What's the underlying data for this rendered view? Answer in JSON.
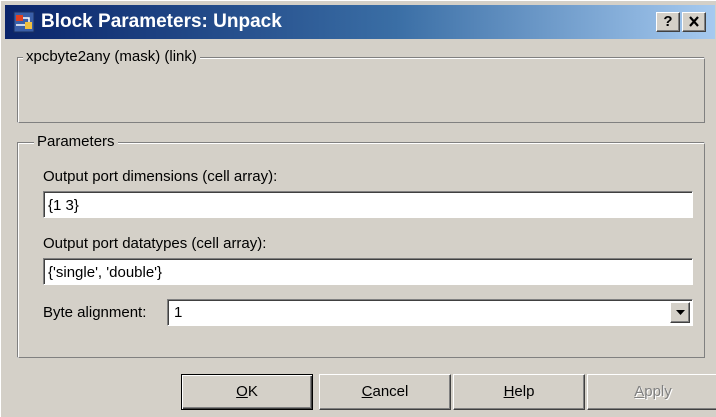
{
  "window": {
    "title": "Block Parameters: Unpack",
    "help_button": "?",
    "close_button": "X"
  },
  "description_group": {
    "title": "xpcbyte2any (mask) (link)"
  },
  "parameters_group": {
    "title": "Parameters",
    "dims_label": "Output port dimensions (cell array):",
    "dims_value": "{1 3}",
    "types_label": "Output port datatypes (cell array):",
    "types_value": "{'single', 'double'}",
    "alignment_label": "Byte alignment:",
    "alignment_value": "1"
  },
  "buttons": {
    "ok": {
      "mnemonic": "O",
      "rest": "K"
    },
    "cancel": {
      "mnemonic": "C",
      "rest": "ancel"
    },
    "help": {
      "mnemonic": "H",
      "rest": "elp"
    },
    "apply": {
      "mnemonic": "A",
      "rest": "pply"
    }
  },
  "colors": {
    "title_gradient_start": "#0a246a",
    "title_gradient_end": "#a6caf0",
    "face": "#d4d0c8"
  }
}
